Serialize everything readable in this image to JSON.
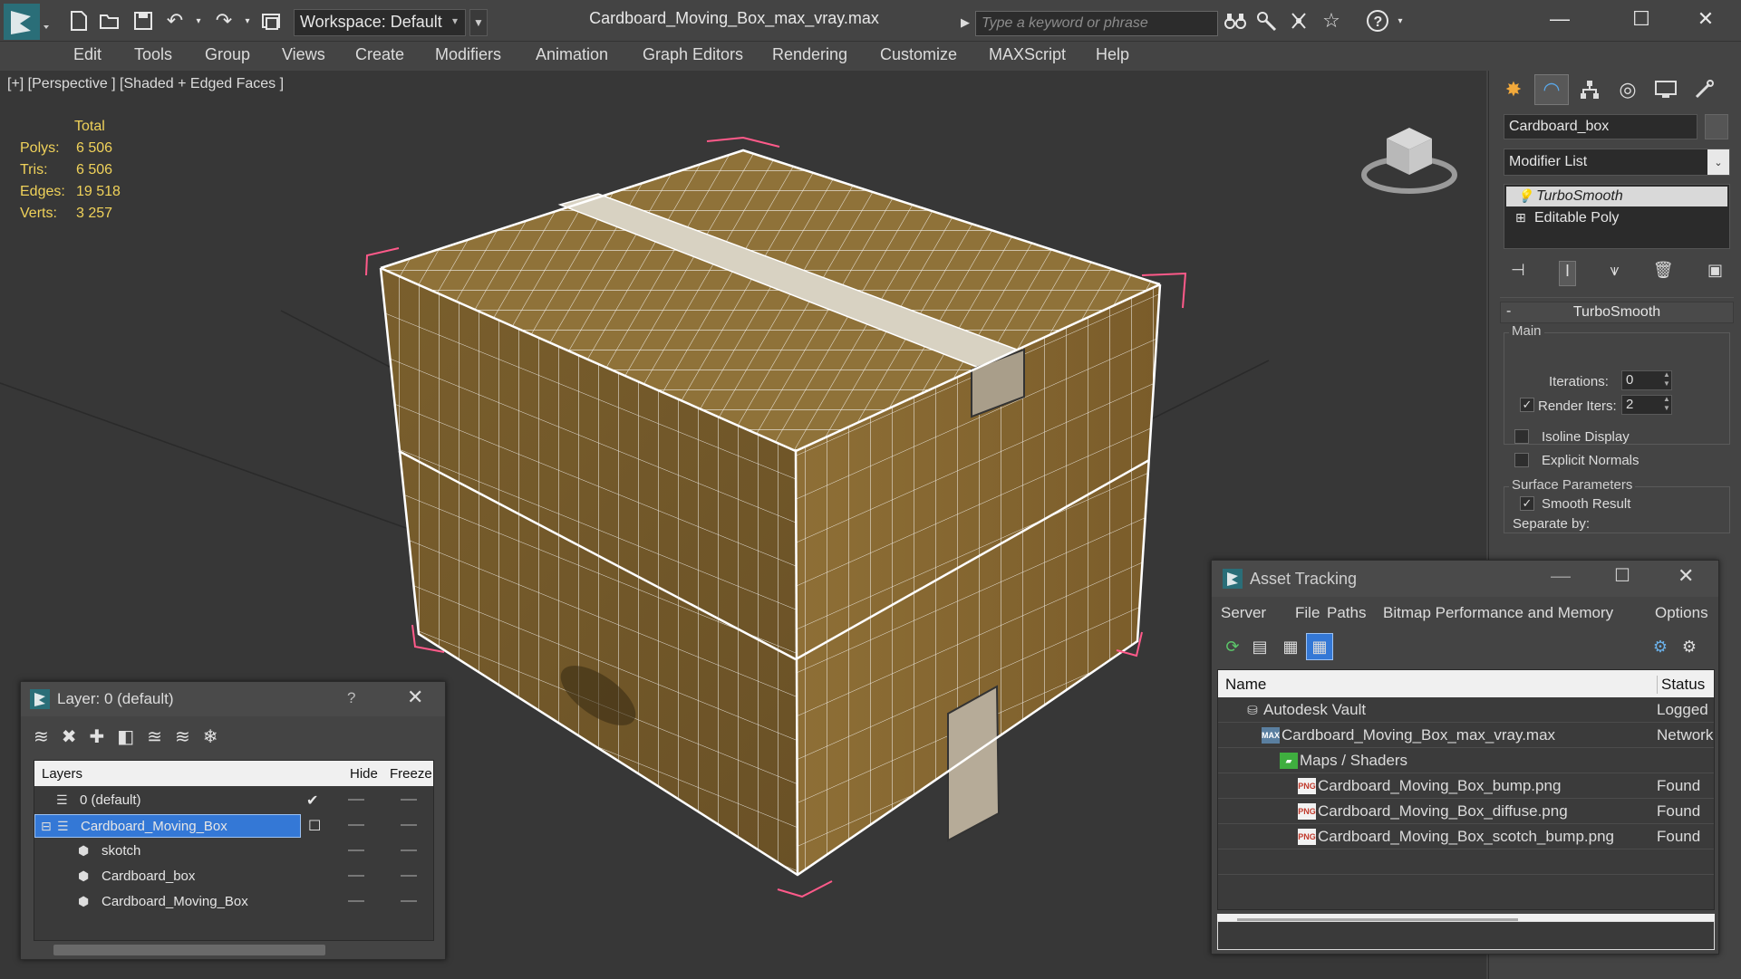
{
  "app": {
    "file_title": "Cardboard_Moving_Box_max_vray.max",
    "workspace": "Workspace: Default",
    "search_placeholder": "Type a keyword or phrase"
  },
  "menu": [
    "Edit",
    "Tools",
    "Group",
    "Views",
    "Create",
    "Modifiers",
    "Animation",
    "Graph Editors",
    "Rendering",
    "Customize",
    "MAXScript",
    "Help"
  ],
  "viewport": {
    "label": "[+] [Perspective ] [Shaded + Edged Faces ]",
    "stats_header": "Total",
    "stats": [
      {
        "label": "Polys:",
        "value": "6 506"
      },
      {
        "label": "Tris:",
        "value": "6 506"
      },
      {
        "label": "Edges:",
        "value": "19 518"
      },
      {
        "label": "Verts:",
        "value": "3 257"
      }
    ]
  },
  "command_panel": {
    "object_name": "Cardboard_box",
    "modifier_list": "Modifier List",
    "stack": [
      "TurboSmooth",
      "Editable Poly"
    ],
    "rollout_title": "TurboSmooth",
    "main_group": "Main",
    "iterations_label": "Iterations:",
    "iterations_value": "0",
    "render_iters_label": "Render Iters:",
    "render_iters_value": "2",
    "isoline": "Isoline Display",
    "explicit_normals": "Explicit Normals",
    "surface_group": "Surface Parameters",
    "smooth_result": "Smooth Result",
    "separate_by": "Separate by:"
  },
  "layer_panel": {
    "title": "Layer: 0 (default)",
    "help": "?",
    "col_layers": "Layers",
    "col_hide": "Hide",
    "col_freeze": "Freeze",
    "rows": [
      {
        "name": "0 (default)"
      },
      {
        "name": "Cardboard_Moving_Box"
      },
      {
        "name": "skotch"
      },
      {
        "name": "Cardboard_box"
      },
      {
        "name": "Cardboard_Moving_Box"
      }
    ]
  },
  "asset_panel": {
    "title": "Asset Tracking",
    "menu": [
      "Server",
      "File",
      "Paths",
      "Bitmap Performance and Memory",
      "Options"
    ],
    "col_name": "Name",
    "col_status": "Status",
    "rows": [
      {
        "name": "Autodesk Vault",
        "status": "Logged",
        "icon": "vault-icon"
      },
      {
        "name": "Cardboard_Moving_Box_max_vray.max",
        "status": "Network",
        "icon": "max-file-icon"
      },
      {
        "name": "Maps / Shaders",
        "status": "",
        "icon": "maps-folder-icon"
      },
      {
        "name": "Cardboard_Moving_Box_bump.png",
        "status": "Found",
        "icon": "png-icon"
      },
      {
        "name": "Cardboard_Moving_Box_diffuse.png",
        "status": "Found",
        "icon": "png-icon"
      },
      {
        "name": "Cardboard_Moving_Box_scotch_bump.png",
        "status": "Found",
        "icon": "png-icon"
      }
    ]
  },
  "colors": {
    "accent": "#3478d6",
    "stats_text": "#f0d25a",
    "cardboard": "#8a6b32",
    "wire": "#ffffff",
    "selection_bracket": "#ff5a8a"
  }
}
